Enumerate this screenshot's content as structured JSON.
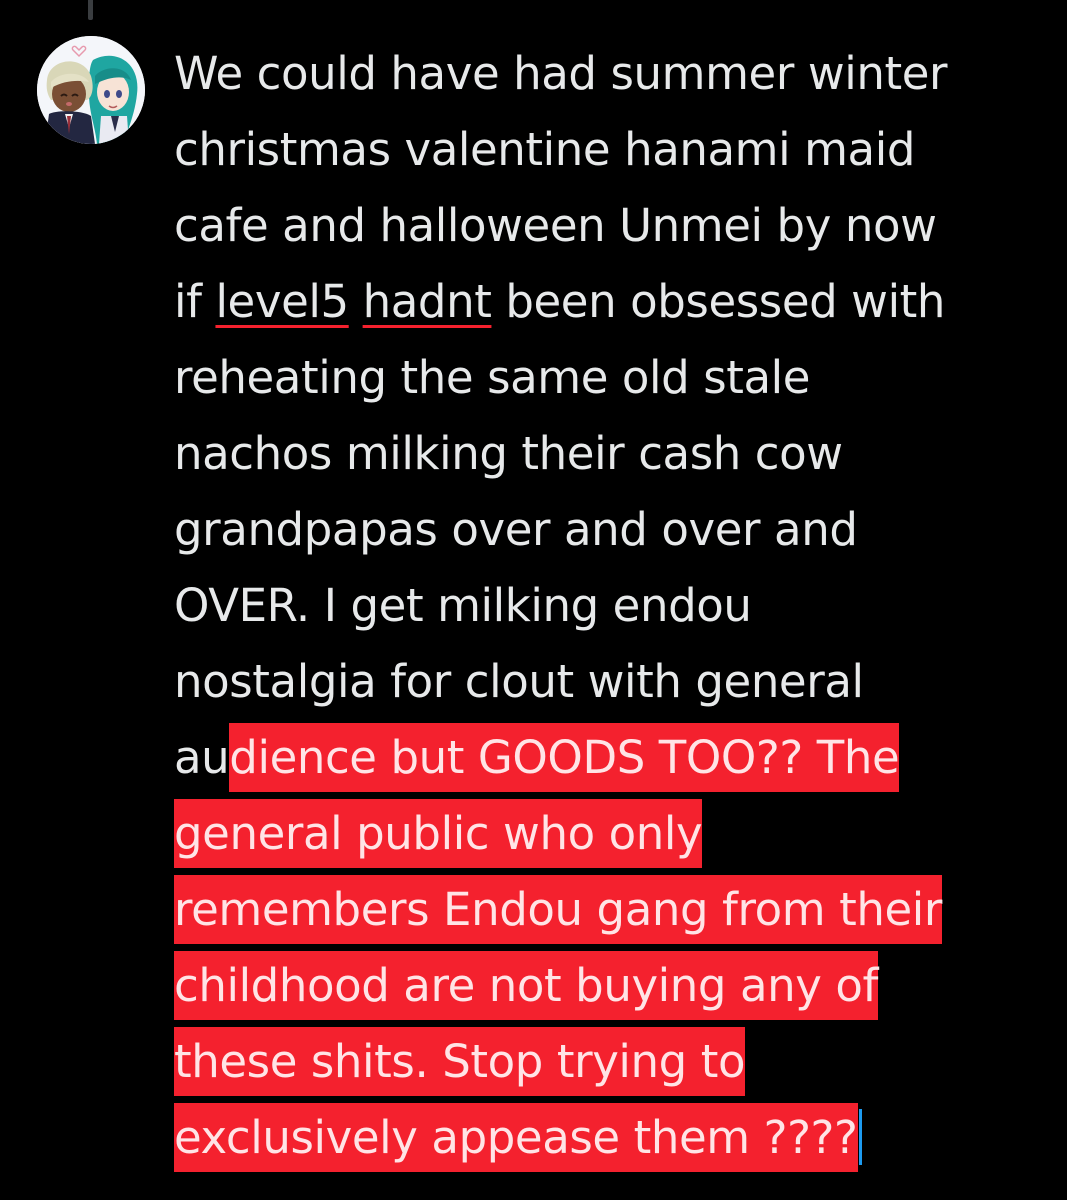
{
  "post": {
    "lines": {
      "l1": "We could have had summer winter",
      "l2": "christmas valentine hanami maid",
      "l3": "cafe and halloween Unmei by now",
      "l4_a": "if ",
      "l4_b": "level5",
      "l4_c": " ",
      "l4_d": "hadnt",
      "l4_e": " been obsessed with",
      "l5": "reheating the same old stale",
      "l6": "nachos milking their cash cow",
      "l7": "grandpapas over and over and",
      "l8": "OVER. I get milking endou",
      "l9": "nostalgia for clout with general",
      "l10_plain": "au",
      "l10_sel": "dience but GOODS TOO?? The",
      "l11": "general public who only",
      "l12": "remembers Endou gang from their",
      "l13": "childhood are not buying any of",
      "l14": "these shits. Stop trying to",
      "l15": "exclusively appease them ????"
    }
  },
  "colors": {
    "background": "#000000",
    "text": "#e7e9ea",
    "selection": "#f4212e",
    "spellcheck_underline": "#f4212e",
    "caret": "#1d9bf0",
    "thread_line": "#3a3d40"
  },
  "icons": {
    "avatar": "user-avatar-image"
  }
}
